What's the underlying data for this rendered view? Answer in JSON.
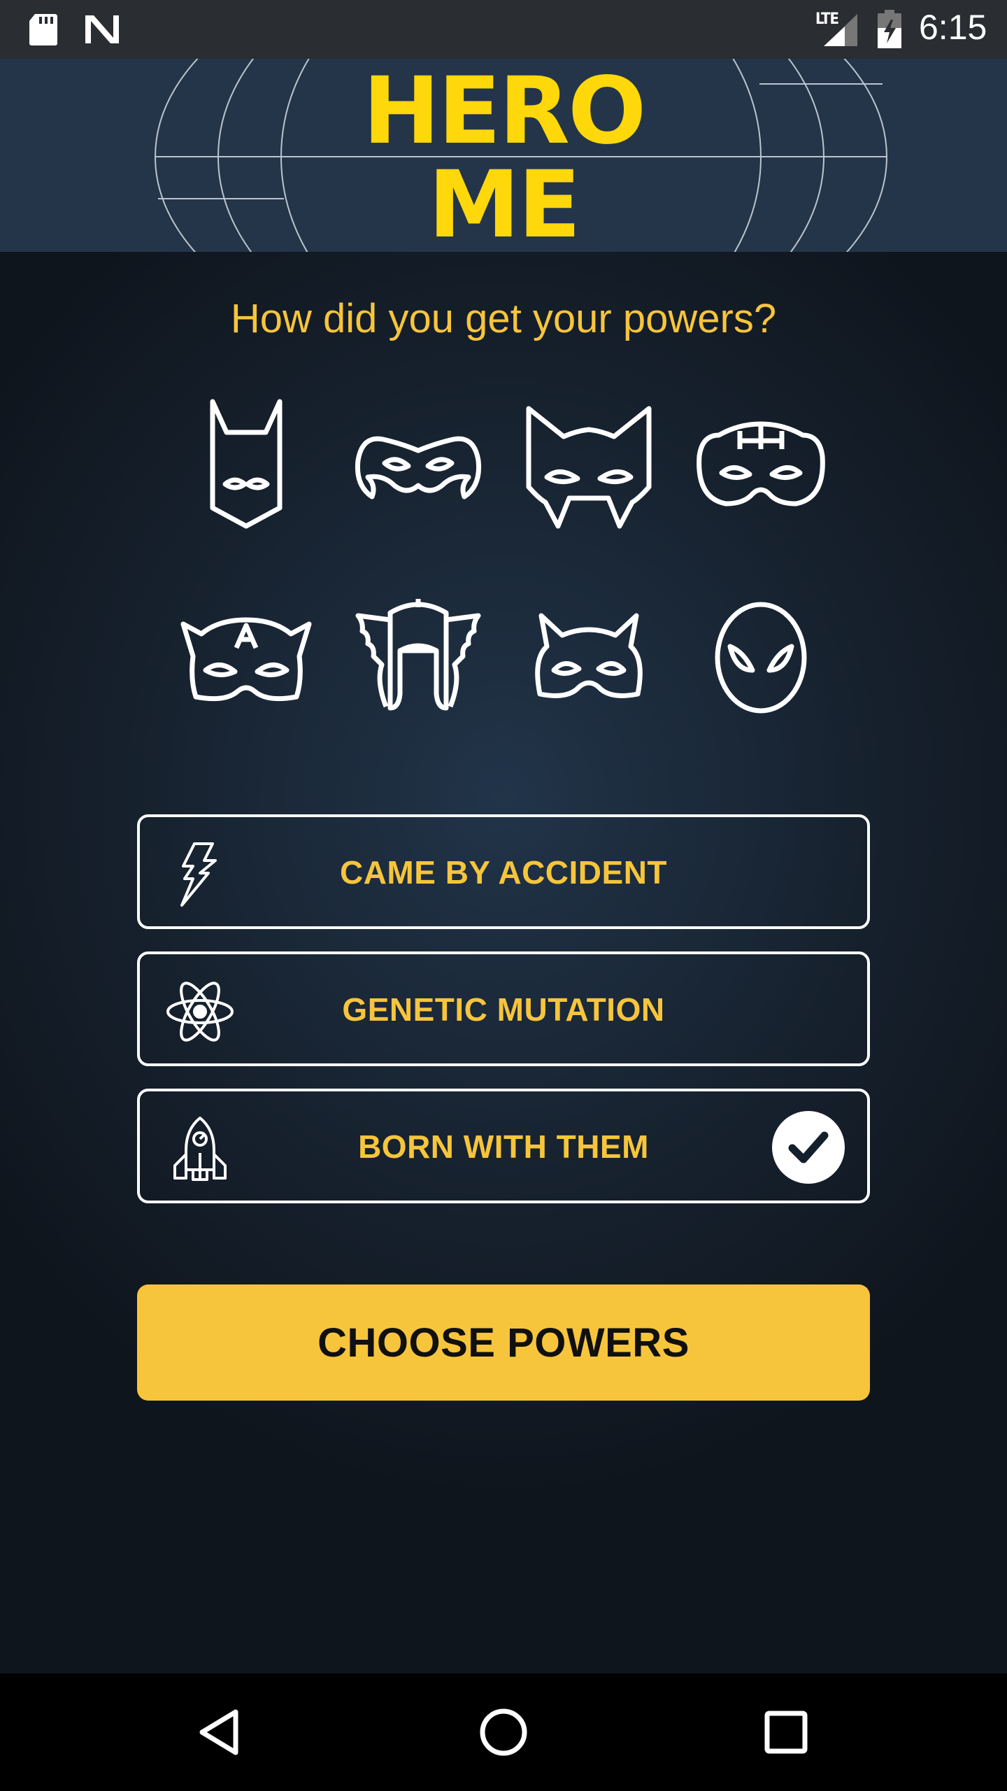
{
  "status_bar": {
    "clock": "6:15",
    "network_label": "LTE",
    "icons": [
      "sd-card-icon",
      "n-notification-icon",
      "signal-icon",
      "battery-charging-icon"
    ]
  },
  "header": {
    "logo_line1": "HERO",
    "logo_line2": "ME"
  },
  "question": "How did you get your powers?",
  "masks": [
    {
      "name": "bat-mask-icon"
    },
    {
      "name": "robin-mask-icon"
    },
    {
      "name": "wolverine-mask-icon"
    },
    {
      "name": "hulk-mask-icon"
    },
    {
      "name": "captain-mask-icon"
    },
    {
      "name": "thor-helmet-icon"
    },
    {
      "name": "cat-mask-icon"
    },
    {
      "name": "spider-mask-icon"
    }
  ],
  "options": [
    {
      "label": "CAME BY ACCIDENT",
      "icon": "lightning-icon",
      "selected": false
    },
    {
      "label": "GENETIC MUTATION",
      "icon": "atom-icon",
      "selected": false
    },
    {
      "label": "BORN WITH THEM",
      "icon": "rocket-icon",
      "selected": true
    }
  ],
  "choose_button": "CHOOSE POWERS",
  "nav_bar": {
    "icons": [
      "back-icon",
      "home-icon",
      "recents-icon"
    ]
  },
  "colors": {
    "accent_yellow": "#f7c53c",
    "logo_yellow": "#fed80a",
    "header_bg": "#243549",
    "background": "#0f151d"
  }
}
